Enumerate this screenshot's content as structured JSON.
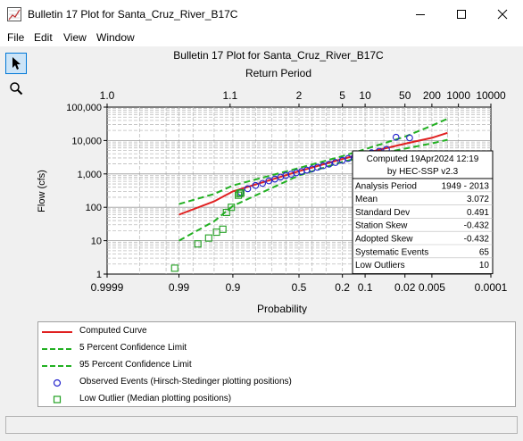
{
  "window": {
    "title": "Bulletin 17 Plot for Santa_Cruz_River_B17C"
  },
  "menu": [
    "File",
    "Edit",
    "View",
    "Window"
  ],
  "tools": [
    {
      "name": "pointer-icon"
    },
    {
      "name": "magnifier-icon"
    }
  ],
  "chart_data": {
    "type": "scatter",
    "title": "Bulletin 17 Plot for Santa_Cruz_River_B17C",
    "top_axis_label": "Return Period",
    "top_ticks": [
      "1.0",
      "1.1",
      "2",
      "5",
      "10",
      "50",
      "200",
      "1000",
      "10000"
    ],
    "xlabel": "Probability",
    "x_ticks": [
      "0.9999",
      "0.99",
      "0.9",
      "0.5",
      "0.2",
      "0.1",
      "0.02",
      "0.005",
      "0.0001"
    ],
    "ylabel": "Flow (cfs)",
    "y_ticks": [
      "100,000",
      "10,000",
      "1,000",
      "100",
      "10",
      "1"
    ],
    "y_scale": "log",
    "ylim": [
      1,
      100000
    ],
    "x_scale": "normal-probability (exceedance)",
    "grid": true,
    "series": [
      {
        "name": "Computed Curve",
        "color": "#e02020",
        "style": "solid",
        "points": [
          [
            0.99,
            60
          ],
          [
            0.95,
            150
          ],
          [
            0.9,
            300
          ],
          [
            0.5,
            1200
          ],
          [
            0.2,
            2800
          ],
          [
            0.1,
            4200
          ],
          [
            0.02,
            8000
          ],
          [
            0.005,
            12000
          ],
          [
            0.002,
            17000
          ]
        ]
      },
      {
        "name": "5 Percent Confidence Limit",
        "color": "#22b022",
        "style": "dashed",
        "points": [
          [
            0.99,
            125
          ],
          [
            0.95,
            250
          ],
          [
            0.9,
            450
          ],
          [
            0.5,
            1500
          ],
          [
            0.2,
            3400
          ],
          [
            0.1,
            5500
          ],
          [
            0.02,
            13000
          ],
          [
            0.005,
            28000
          ],
          [
            0.002,
            45000
          ]
        ]
      },
      {
        "name": "95 Percent Confidence Limit",
        "color": "#22b022",
        "style": "dashed",
        "points": [
          [
            0.99,
            10
          ],
          [
            0.95,
            38
          ],
          [
            0.9,
            110
          ],
          [
            0.5,
            900
          ],
          [
            0.2,
            2300
          ],
          [
            0.1,
            3300
          ],
          [
            0.02,
            5700
          ],
          [
            0.005,
            8200
          ],
          [
            0.002,
            10500
          ]
        ]
      },
      {
        "name": "Observed Events (Hirsch-Stedinger plotting positions)",
        "color": "#2222cc",
        "marker": "circle",
        "points": [
          [
            0.87,
            280
          ],
          [
            0.84,
            360
          ],
          [
            0.8,
            450
          ],
          [
            0.76,
            520
          ],
          [
            0.72,
            620
          ],
          [
            0.68,
            700
          ],
          [
            0.64,
            800
          ],
          [
            0.6,
            900
          ],
          [
            0.56,
            980
          ],
          [
            0.52,
            1080
          ],
          [
            0.48,
            1180
          ],
          [
            0.44,
            1300
          ],
          [
            0.4,
            1420
          ],
          [
            0.36,
            1580
          ],
          [
            0.32,
            1750
          ],
          [
            0.28,
            1950
          ],
          [
            0.24,
            2200
          ],
          [
            0.2,
            2550
          ],
          [
            0.17,
            2900
          ],
          [
            0.14,
            3300
          ],
          [
            0.11,
            3800
          ],
          [
            0.08,
            4300
          ],
          [
            0.06,
            4800
          ],
          [
            0.045,
            5400
          ],
          [
            0.03,
            12500
          ],
          [
            0.016,
            12000
          ]
        ]
      },
      {
        "name": "Low Outlier (Median plotting positions)",
        "color": "#22a022",
        "marker": "square",
        "points": [
          [
            0.992,
            1.5
          ],
          [
            0.975,
            8
          ],
          [
            0.96,
            12
          ],
          [
            0.945,
            18
          ],
          [
            0.93,
            22
          ],
          [
            0.92,
            70
          ],
          [
            0.905,
            100
          ],
          [
            0.88,
            230
          ],
          [
            0.875,
            260
          ],
          [
            0.87,
            270
          ]
        ]
      }
    ],
    "annotation": {
      "header": [
        "Computed 19Apr2024 12:19",
        "by HEC-SSP v2.3"
      ],
      "rows": [
        [
          "Analysis Period",
          "1949 - 2013"
        ],
        [
          "Mean",
          "3.072"
        ],
        [
          "Standard Dev",
          "0.491"
        ],
        [
          "Station Skew",
          "-0.432"
        ],
        [
          "Adopted Skew",
          "-0.432"
        ],
        [
          "Systematic Events",
          "65"
        ],
        [
          "Low Outliers",
          "10"
        ]
      ]
    }
  },
  "legend": [
    {
      "label": "Computed Curve",
      "kind": "line",
      "color": "#e02020"
    },
    {
      "label": "5 Percent Confidence Limit",
      "kind": "dash",
      "color": "#22b022"
    },
    {
      "label": "95 Percent Confidence Limit",
      "kind": "dash",
      "color": "#22b022"
    },
    {
      "label": "Observed Events (Hirsch-Stedinger plotting positions)",
      "kind": "circle",
      "color": "#2222cc"
    },
    {
      "label": "Low Outlier (Median plotting positions)",
      "kind": "square",
      "color": "#22a022"
    }
  ],
  "status": {
    "text": ""
  }
}
